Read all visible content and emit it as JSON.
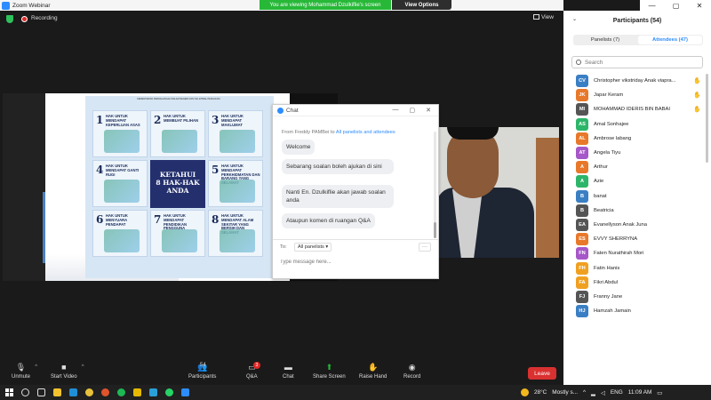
{
  "window": {
    "title": "Zoom Webinar",
    "viewing_banner": "You are viewing Mohammad Dzulkiflie's screen",
    "view_options": "View Options",
    "controls": [
      "—",
      "▢",
      "✕"
    ]
  },
  "meeting": {
    "recording_label": "Recording",
    "view_label": "View"
  },
  "poster": {
    "header": "KEMENTERIAN PERDAGANGAN DALAM NEGERI DAN HAL EHWAL PENGGUNA",
    "center_line1": "KETAHUI",
    "center_line2": "8 HAK-HAK",
    "center_line3": "ANDA",
    "rights": [
      {
        "num": "1",
        "text": "HAK UNTUK MENDAPAT KEPERLUAN ASAS"
      },
      {
        "num": "2",
        "text": "HAK UNTUK MEMBUAT PILIHAN"
      },
      {
        "num": "3",
        "text": "HAK UNTUK MENDAPAT MAKLUMAT"
      },
      {
        "num": "4",
        "text": "HAK UNTUK MENDAPAT GANTI RUGI"
      },
      {
        "num": "5",
        "text": "HAK UNTUK MENDAPAT PERKHIDMATAN DAN BARANG YANG SELAMAT"
      },
      {
        "num": "6",
        "text": "HAK UNTUK MENYUARA PENDAPAT"
      },
      {
        "num": "7",
        "text": "HAK UNTUK MENDAPAT PENDIDIKAN PENGGUNA"
      },
      {
        "num": "8",
        "text": "HAK UNTUK MENDAPAT ALAM SEKITAR YANG BERSIH DAN SELAMAT"
      }
    ]
  },
  "chat": {
    "title": "Chat",
    "from_prefix": "From ",
    "from_name": "Freddy PAMBei",
    "from_mid": " to ",
    "from_target": "All panelists and attendees",
    "messages": [
      "Welcome",
      "Sebarang soalan boleh ajukan di sini",
      "Nanti En. Dzulkiflie akan jawab soalan anda",
      "Ataupun komen di ruangan Q&A"
    ],
    "to_label": "To:",
    "to_value": "All panelists ▾",
    "more": "···",
    "placeholder": "Type message here..."
  },
  "toolbar": {
    "unmute": "Unmute",
    "start_video": "Start Video",
    "participants": "Participants",
    "participants_count": "54",
    "qa": "Q&A",
    "qa_badge": "3",
    "chat": "Chat",
    "share_screen": "Share Screen",
    "raise_hand": "Raise Hand",
    "record": "Record",
    "leave": "Leave"
  },
  "participants_panel": {
    "title": "Participants (54)",
    "tab_panelists": "Panelists (7)",
    "tab_attendees": "Attendees (47)",
    "search_placeholder": "Search",
    "list": [
      {
        "initials": "CV",
        "name": "Christopher vikstriday Anak viapra...",
        "color": "#3a7fc4",
        "hand": true
      },
      {
        "initials": "JK",
        "name": "Japar Keram",
        "color": "#e8782a",
        "hand": true
      },
      {
        "initials": "MI",
        "name": "MOHAMMAD IDERIS BIN BABAI",
        "color": "#555555",
        "hand": true
      },
      {
        "initials": "AS",
        "name": "Amal Sonhajee",
        "color": "#2db56a",
        "hand": false
      },
      {
        "initials": "AL",
        "name": "Ambrose labang",
        "color": "#e8782a",
        "hand": false
      },
      {
        "initials": "AT",
        "name": "Angela Tiyu",
        "color": "#a657c8",
        "hand": false
      },
      {
        "initials": "A",
        "name": "Arthur",
        "color": "#e8782a",
        "hand": false
      },
      {
        "initials": "A",
        "name": "Azie",
        "color": "#2db56a",
        "hand": false
      },
      {
        "initials": "B",
        "name": "banat",
        "color": "#3a7fc4",
        "hand": false
      },
      {
        "initials": "B",
        "name": "Beatricia",
        "color": "#555555",
        "hand": false
      },
      {
        "initials": "EA",
        "name": "Evanellyson Anak Juna",
        "color": "#555555",
        "hand": false
      },
      {
        "initials": "ES",
        "name": "EVVY SHERRYNA",
        "color": "#e8782a",
        "hand": false
      },
      {
        "initials": "FN",
        "name": "Faten Nurathirah Mori",
        "color": "#a657c8",
        "hand": false
      },
      {
        "initials": "FH",
        "name": "Fatin Hanis",
        "color": "#f0a020",
        "hand": false
      },
      {
        "initials": "FA",
        "name": "Fikri Abdul",
        "color": "#f0a020",
        "hand": false
      },
      {
        "initials": "FJ",
        "name": "Franny Jane",
        "color": "#555555",
        "hand": false
      },
      {
        "initials": "HJ",
        "name": "Hamzah Jamain",
        "color": "#3a7fc4",
        "hand": false
      }
    ]
  },
  "taskbar": {
    "weather_temp": "28°C",
    "weather_text": "Mostly s...",
    "lang": "ENG",
    "time": "11:09 AM"
  }
}
